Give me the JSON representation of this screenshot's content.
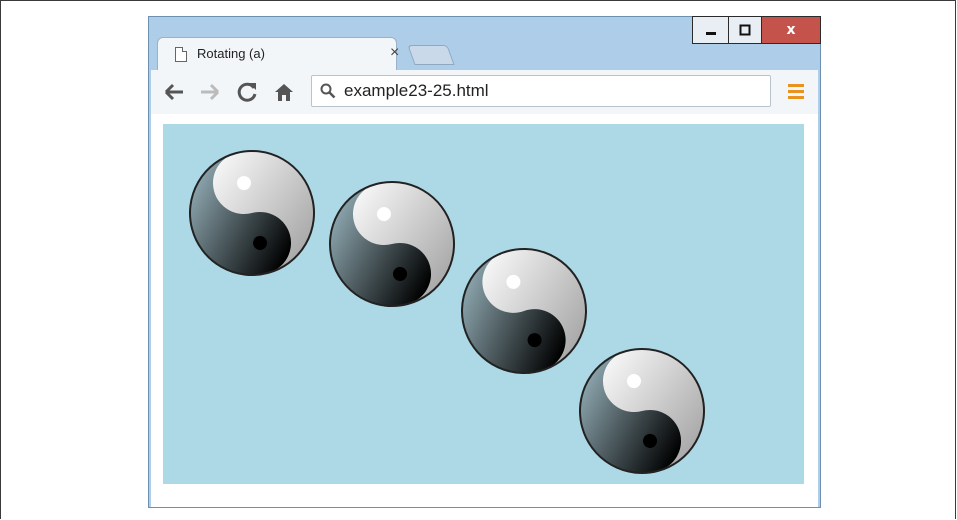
{
  "window": {
    "controls": {
      "minimize": "minimize",
      "maximize": "maximize",
      "close": "x"
    }
  },
  "tab": {
    "title": "Rotating (a)",
    "close_label": "×"
  },
  "toolbar": {
    "back_icon": "back-arrow-icon",
    "forward_icon": "forward-arrow-icon",
    "reload_icon": "reload-icon",
    "home_icon": "home-icon",
    "menu_icon": "hamburger-menu-icon"
  },
  "address_bar": {
    "url": "example23-25.html"
  },
  "content": {
    "background": "#add8e6",
    "symbol": "yin-yang",
    "symbol_count": 4
  },
  "colors": {
    "frame": "#aecde8",
    "close_button": "#c4534b",
    "menu_accent": "#e8931e"
  }
}
